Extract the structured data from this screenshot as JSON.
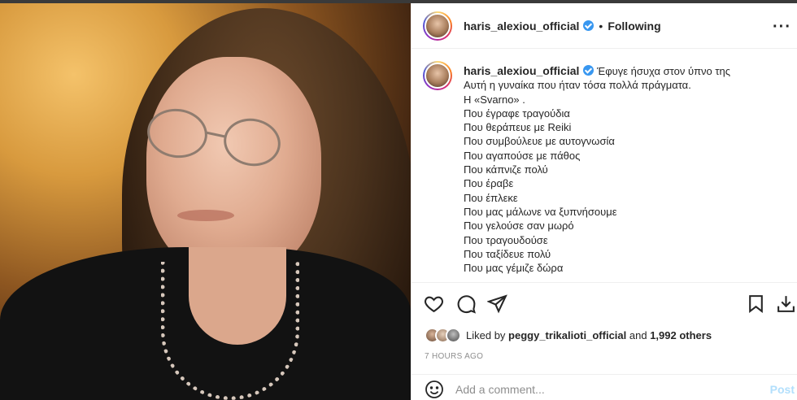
{
  "post": {
    "username": "haris_alexiou_official",
    "verified": true,
    "separator": "•",
    "follow_status": "Following",
    "more_icon": "more-horizontal-icon"
  },
  "caption": {
    "username": "haris_alexiou_official",
    "lines": [
      "Έφυγε ήσυχα στον ύπνο της",
      "Αυτή η γυναίκα που ήταν τόσα πολλά πράγματα.",
      "Η «Svarno» .",
      "Που έγραφε τραγούδια",
      "Που θεράπευε με Reiki",
      "Που συμβούλευε με αυτογνωσία",
      "Που αγαπούσε με πάθος",
      "Που κάπνιζε πολύ",
      "Που έραβε",
      "Που έπλεκε",
      "Που μας μάλωνε να ξυπνήσουμε",
      "Που γελούσε σαν μωρό",
      "Που τραγουδούσε",
      "Που ταξίδευε πολύ",
      "Που μας γέμιζε δώρα"
    ]
  },
  "actions": {
    "like_icon": "heart-icon",
    "comment_icon": "comment-icon",
    "share_icon": "share-icon",
    "save_icon": "bookmark-icon",
    "download_icon": "download-icon"
  },
  "likes": {
    "prefix": "Liked by",
    "user": "peggy_trikalioti_official",
    "connector": "and",
    "others": "1,992 others"
  },
  "timestamp": "7 HOURS AGO",
  "comment": {
    "placeholder": "Add a comment...",
    "post_label": "Post",
    "emoji_icon": "emoji-icon"
  },
  "colors": {
    "verified": "#3897f0",
    "post_disabled": "#b2dffc",
    "muted": "#8e8e8e",
    "text": "#262626"
  }
}
